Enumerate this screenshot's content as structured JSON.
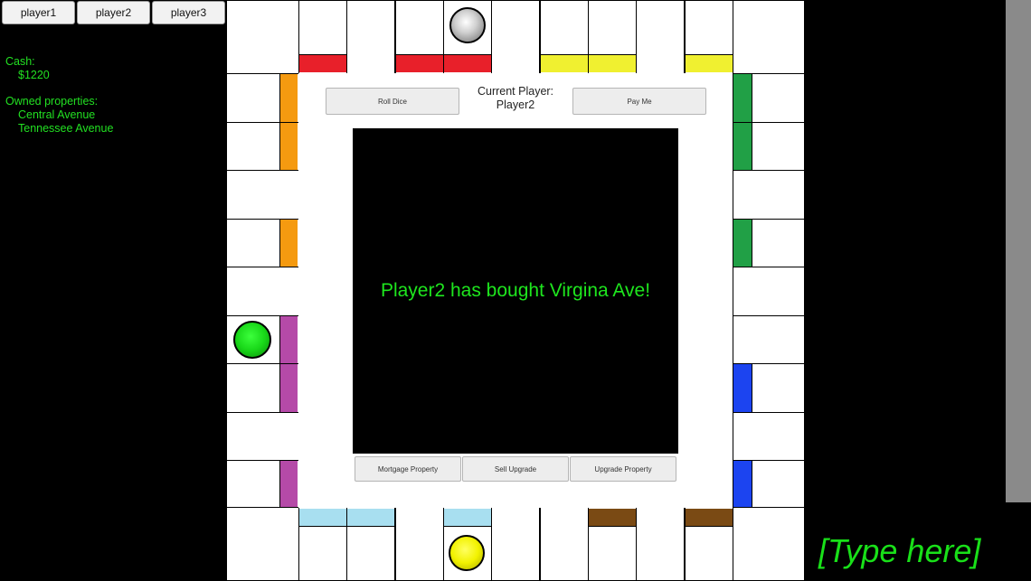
{
  "tabs": [
    "player1",
    "player2",
    "player3"
  ],
  "info": {
    "cash_label": "Cash:",
    "cash_value": "$1220",
    "owned_label": "Owned properties:",
    "owned": [
      "Central Avenue",
      "Tennessee Avenue"
    ]
  },
  "controls": {
    "roll_dice": "Roll Dice",
    "current_player_label": "Current Player:",
    "current_player_name": "Player2",
    "pay_me": "Pay Me",
    "mortgage": "Mortgage Property",
    "sell_upgrade": "Sell Upgrade",
    "upgrade": "Upgrade Property"
  },
  "message": "Player2 has bought Virgina Ave!",
  "console_placeholder": "[Type here]",
  "colors": {
    "red": "#e8202a",
    "yellow": "#f0f030",
    "orange": "#f59a10",
    "green": "#21a046",
    "purple": "#b54aa8",
    "blue": "#1c44f0",
    "light_blue": "#a8dff0",
    "brown": "#7a4a14",
    "text_green": "#22e022"
  },
  "tokens": [
    "silver-token",
    "green-token",
    "yellow-token"
  ]
}
